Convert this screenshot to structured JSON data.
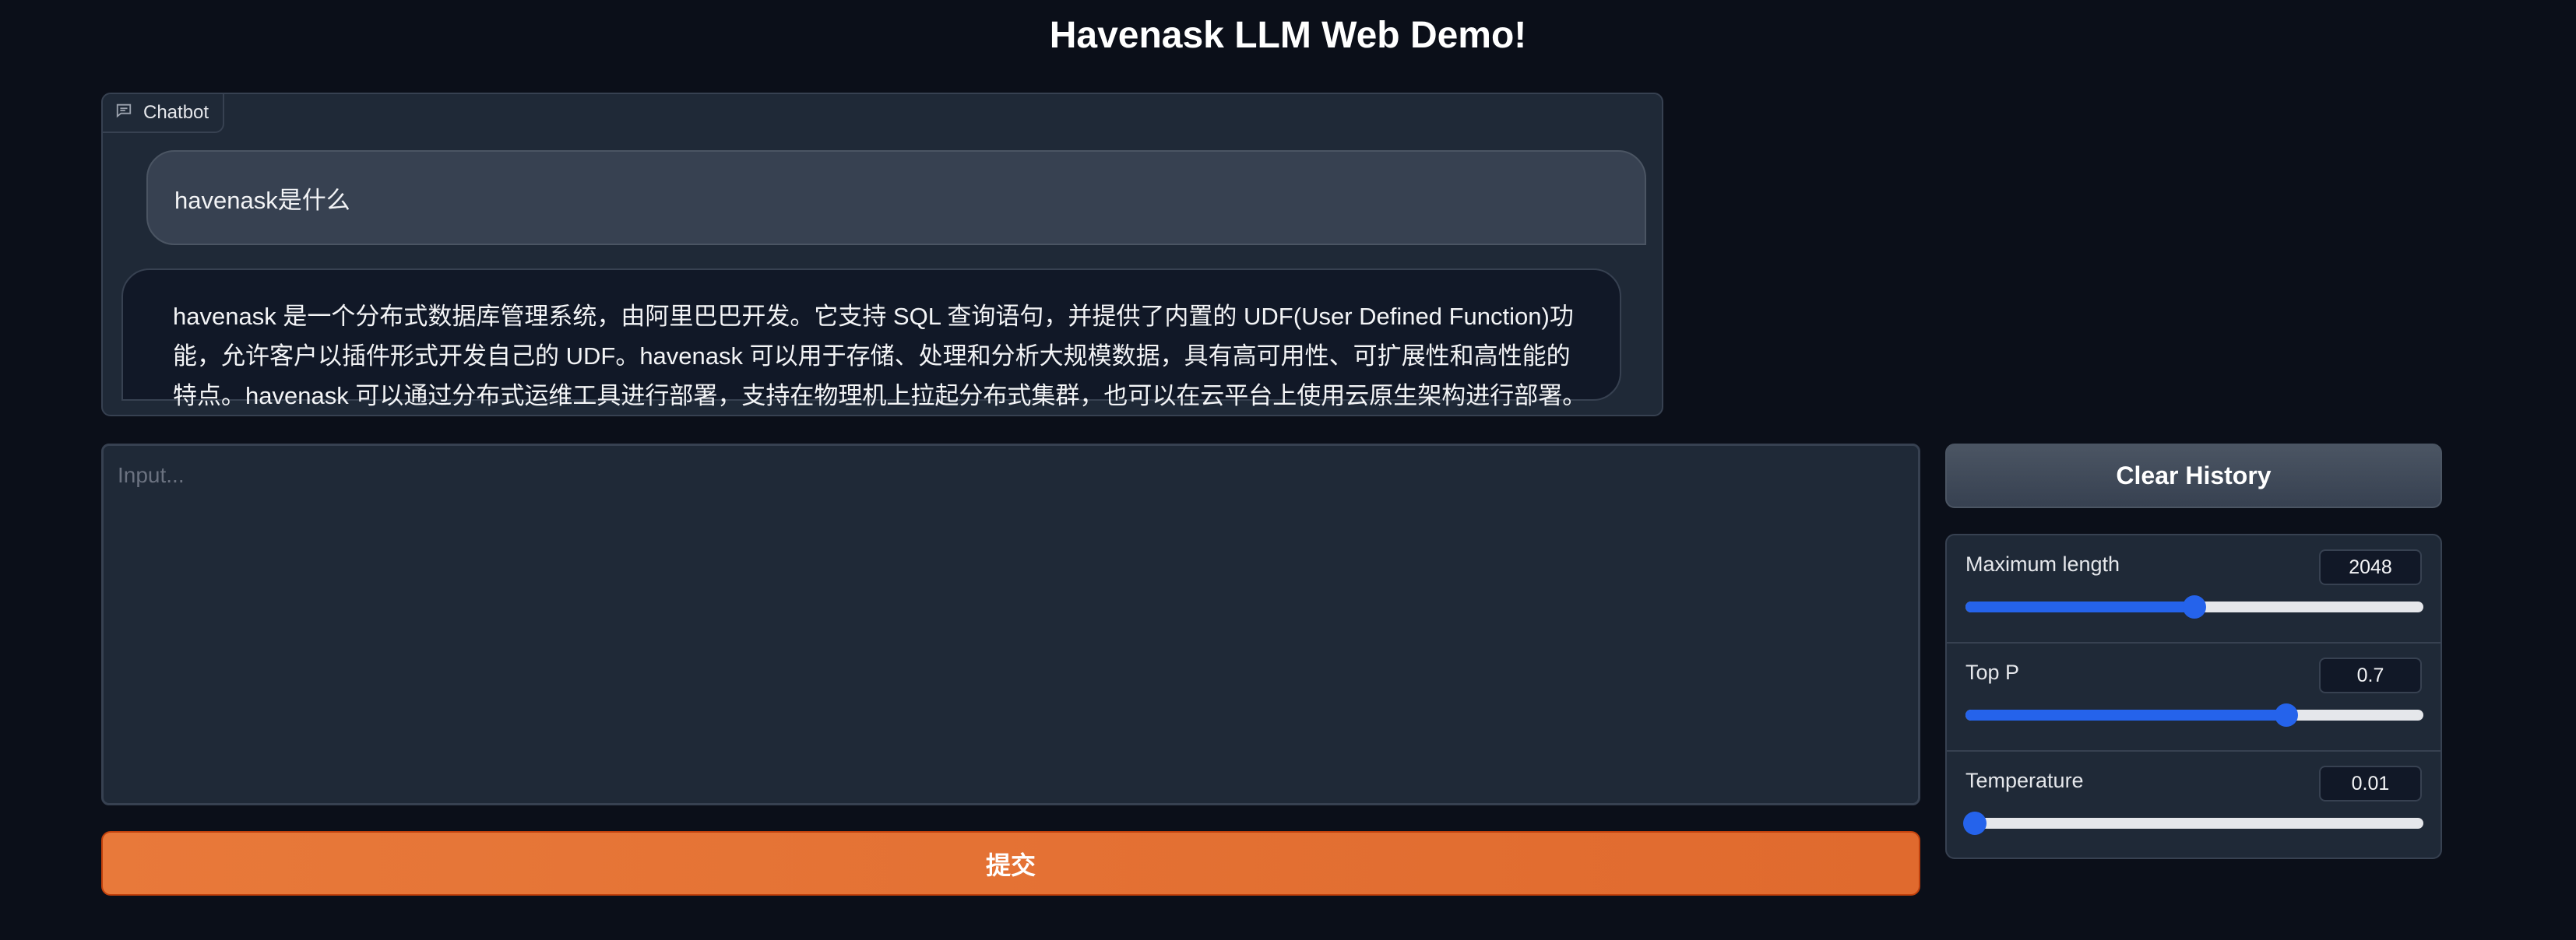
{
  "page": {
    "title": "Havenask LLM Web Demo!"
  },
  "chatbot": {
    "label": "Chatbot",
    "icon": "chat-bubble-icon",
    "messages": [
      {
        "role": "user",
        "text": "havenask是什么"
      },
      {
        "role": "bot",
        "text": "havenask 是一个分布式数据库管理系统，由阿里巴巴开发。它支持 SQL 查询语句，并提供了内置的 UDF(User Defined Function)功能，允许客户以插件形式开发自己的 UDF。havenask 可以用于存储、处理和分析大规模数据，具有高可用性、可扩展性和高性能的特点。havenask 可以通过分布式运维工具进行部署，支持在物理机上拉起分布式集群，也可以在云平台上使用云原生架构进行部署。"
      }
    ]
  },
  "input": {
    "placeholder": "Input...",
    "value": ""
  },
  "buttons": {
    "submit_label": "提交",
    "clear_label": "Clear History"
  },
  "sliders": [
    {
      "label": "Maximum length",
      "value": "2048",
      "fraction": 0.5
    },
    {
      "label": "Top P",
      "value": "0.7",
      "fraction": 0.7
    },
    {
      "label": "Temperature",
      "value": "0.01",
      "fraction": 0.01
    }
  ],
  "colors": {
    "accent": "#2563eb",
    "submit": "#e8793a",
    "background": "#0b0f19"
  }
}
